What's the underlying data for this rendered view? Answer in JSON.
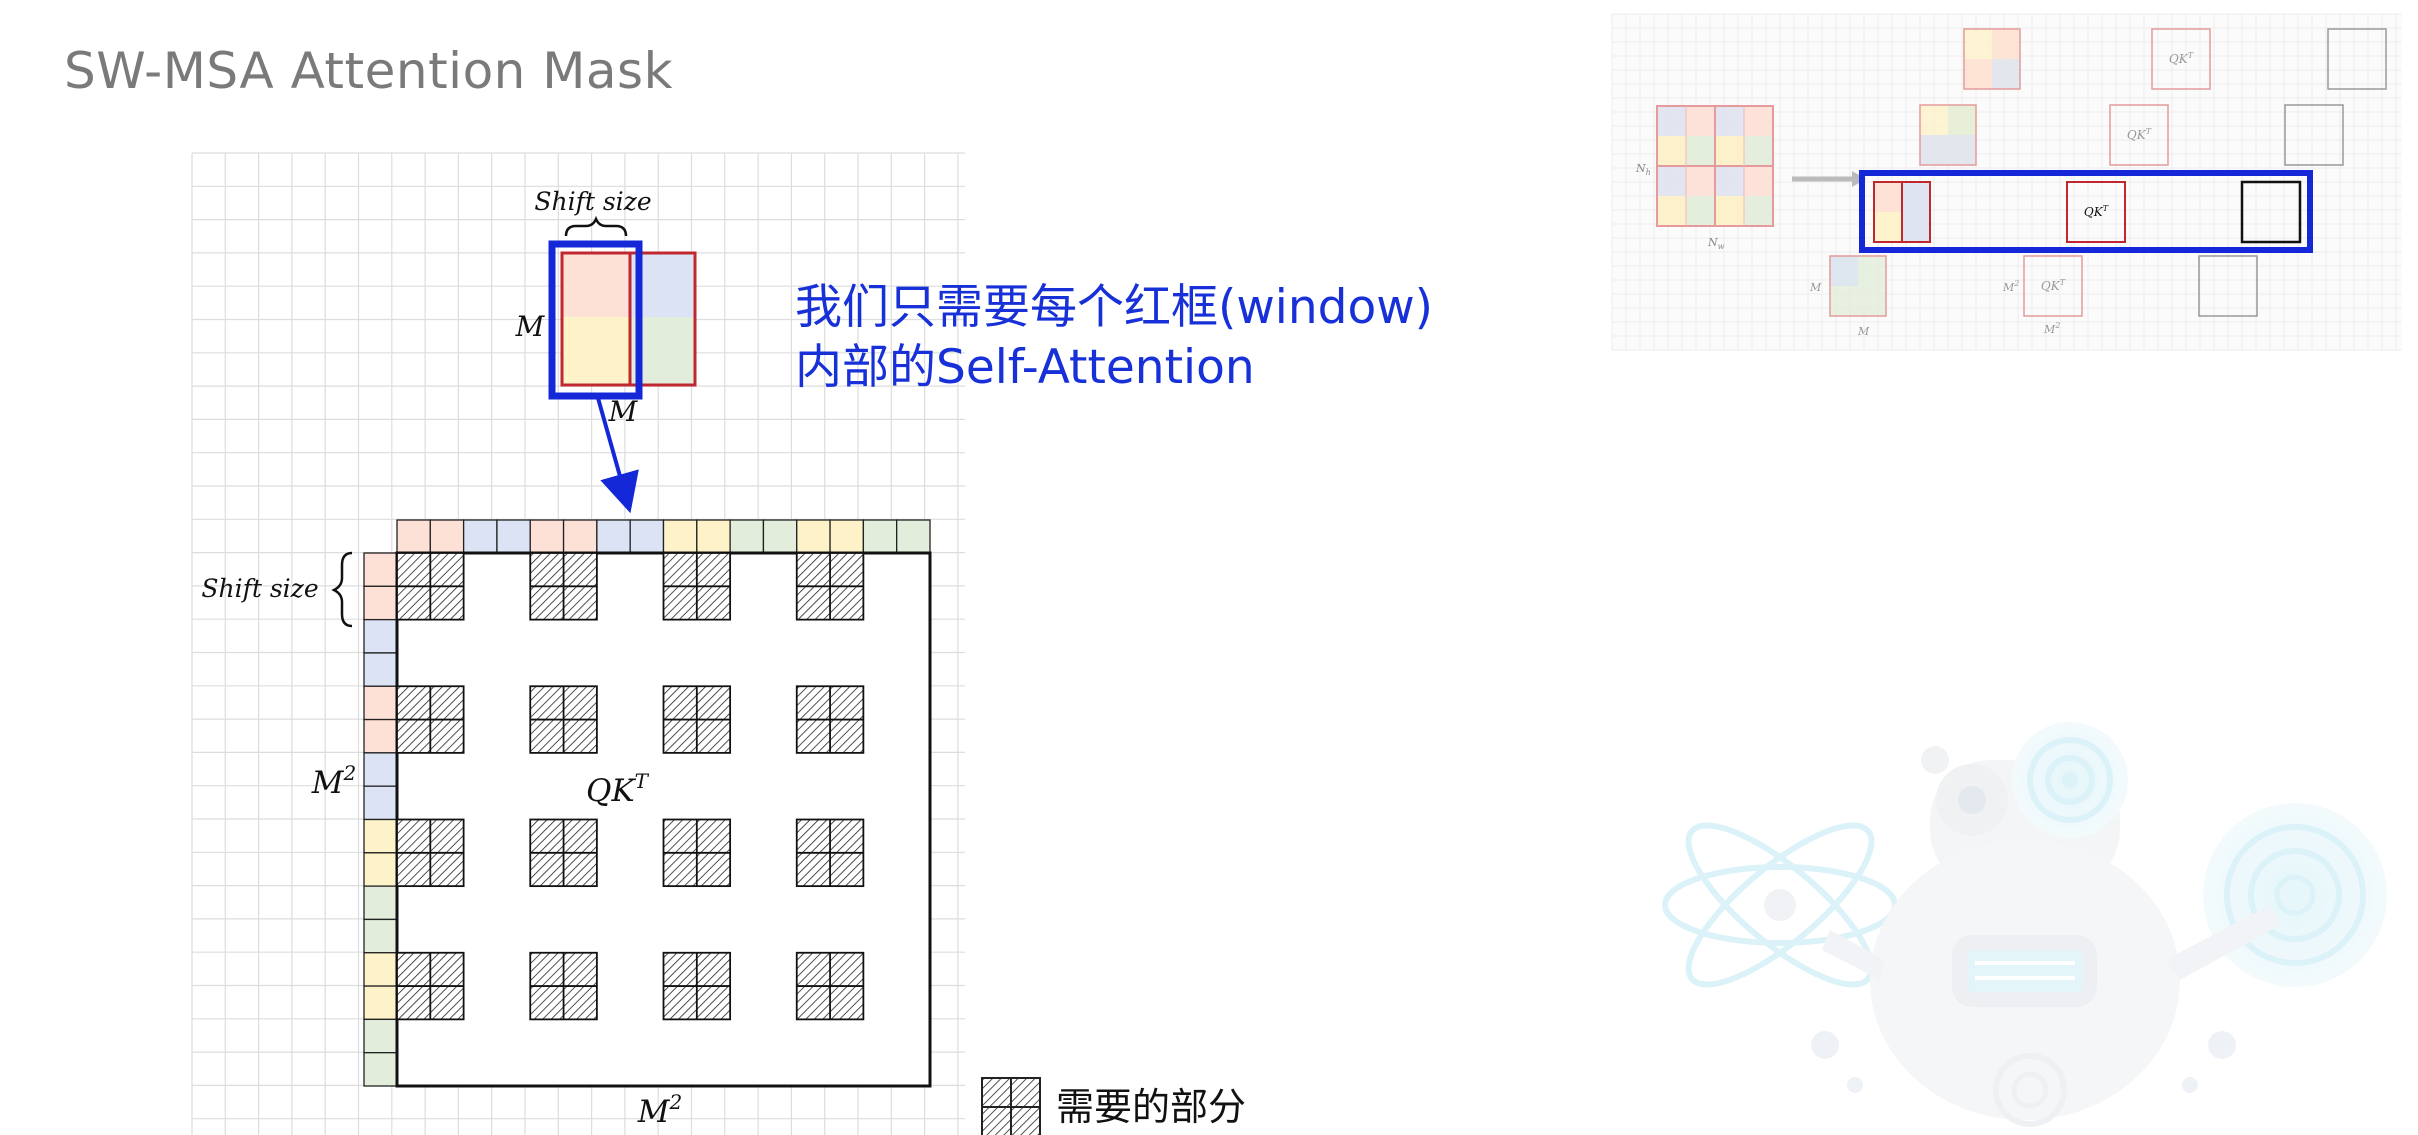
{
  "slide": {
    "title": "SW-MSA Attention Mask",
    "annotation": "我们只需要每个红框(window)内部的Self-Attention",
    "annotation_line1": "我们只需要每个红框(window)",
    "annotation_line2": "内部的Self-Attention"
  },
  "main_diagram": {
    "shift_size_top": "Shift size",
    "shift_size_left": "Shift size",
    "window_side_label": "M",
    "window_bottom_label": "M",
    "matrix_label": "QK",
    "matrix_label_sup": "T",
    "matrix_height_label": "M",
    "matrix_height_sup": "2",
    "matrix_width_label": "M",
    "matrix_width_sup": "2"
  },
  "legend": {
    "label": "需要的部分"
  },
  "thumbnail": {
    "left_side_label": "N",
    "left_side_sub": "h",
    "bottom_label": "N",
    "bottom_sub": "w",
    "qk_label": "QK",
    "qk_sup": "T",
    "row_labels": [
      "M",
      "M",
      "M",
      "M"
    ],
    "m2_label": "M",
    "m2_sup": "2"
  },
  "colors": {
    "pink": "#fde0d6",
    "blue": "#dce3f4",
    "yellow": "#fdf2c8",
    "green": "#e2eedb",
    "red_frame": "#c0282f",
    "blue_frame": "#1428d8",
    "grid": "#dddddd",
    "matrix_border": "#111111"
  }
}
